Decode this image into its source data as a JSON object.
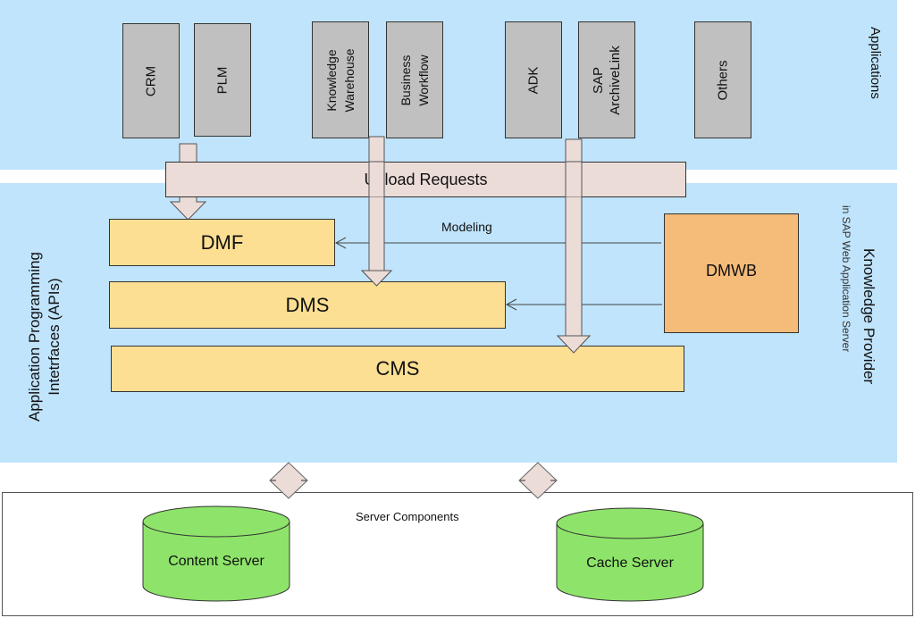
{
  "diagram": {
    "applications_layer": {
      "title": "Applications",
      "apps": [
        {
          "line1": "CRM",
          "line2": ""
        },
        {
          "line1": "PLM",
          "line2": ""
        },
        {
          "line1": "Knowledge",
          "line2": "Warehouse"
        },
        {
          "line1": "Business",
          "line2": "Workflow"
        },
        {
          "line1": "ADK",
          "line2": ""
        },
        {
          "line1": "SAP",
          "line2": "ArchiveLink"
        },
        {
          "line1": "Others",
          "line2": ""
        }
      ]
    },
    "upload_requests": "Upload Requests",
    "api_layer": {
      "left_label_line1": "Application Programming",
      "left_label_line2": "Intetrfaces (APIs)",
      "right_title": "Knowledge Provider",
      "right_subtitle": "in SAP Web Application Server",
      "components": {
        "dmf": "DMF",
        "dms": "DMS",
        "cms": "CMS",
        "dmwb": "DMWB"
      },
      "modeling_label": "Modeling"
    },
    "server_layer": {
      "title": "Server Components",
      "servers": [
        "Content Server",
        "Cache Server"
      ]
    },
    "colors": {
      "band_blue": "#c0e4fc",
      "app_gray": "#c0c0c0",
      "upload_pink": "#ebdcd8",
      "component_yellow": "#fddf93",
      "dmwb_orange": "#f5bb78",
      "server_green": "#8ee46a"
    }
  }
}
